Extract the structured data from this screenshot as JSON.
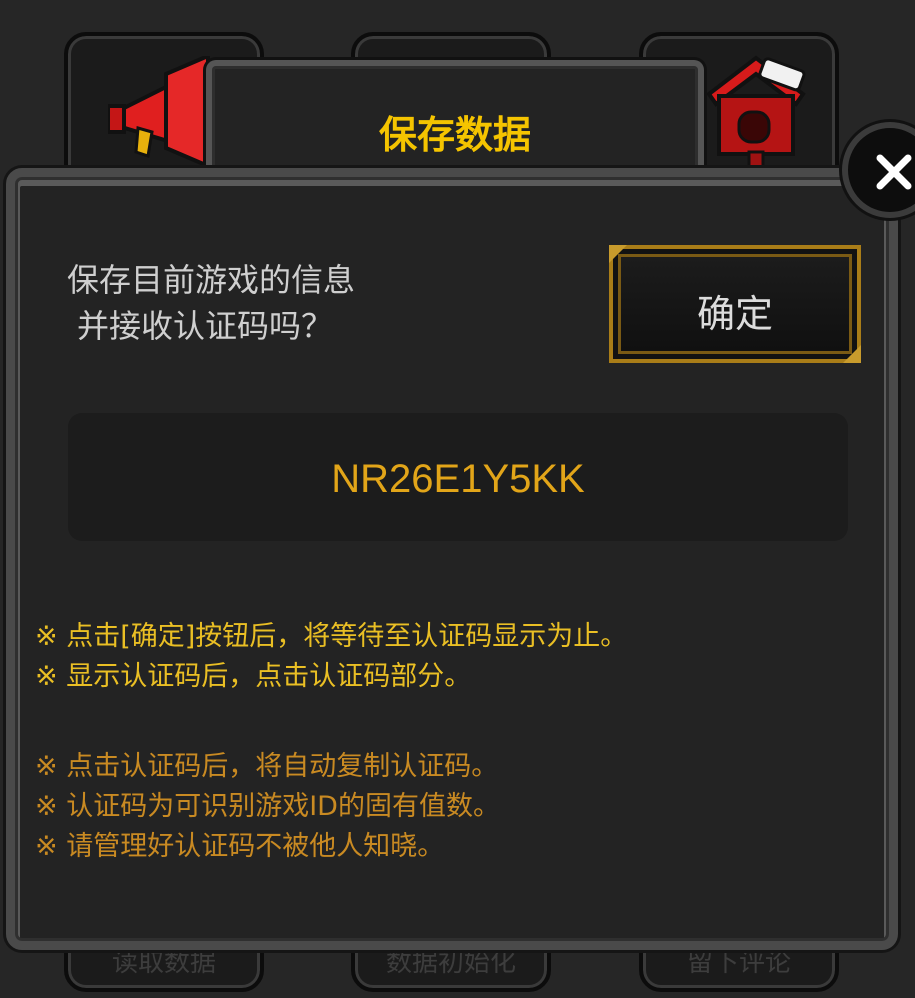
{
  "dialog": {
    "title": "保存数据",
    "question_line1": "保存目前游戏的信息",
    "question_line2": "并接收认证码吗？",
    "confirm_label": "确定",
    "auth_code": "NR26E1Y5KK",
    "close_icon": "close-icon"
  },
  "notes_primary": [
    "※ 点击[确定]按钮后，将等待至认证码显示为止。",
    " ※ 显示认证码后，点击认证码部分。"
  ],
  "notes_secondary": [
    "※ 点击认证码后，将自动复制认证码。",
    " ※ 认证码为可识别游戏ID的固有值数。",
    " ※ 请管理好认证码不被他人知晓。"
  ],
  "background_menu": {
    "icons": [
      "megaphone-icon",
      "mailbox-post-icon"
    ],
    "captions": [
      "读取数据",
      "数据初始化",
      "留下评论"
    ]
  },
  "colors": {
    "title": "#f5c400",
    "auth_code": "#e2a519",
    "note_primary": "#eabf24",
    "note_secondary": "#c98a22",
    "panel": "#232323"
  }
}
